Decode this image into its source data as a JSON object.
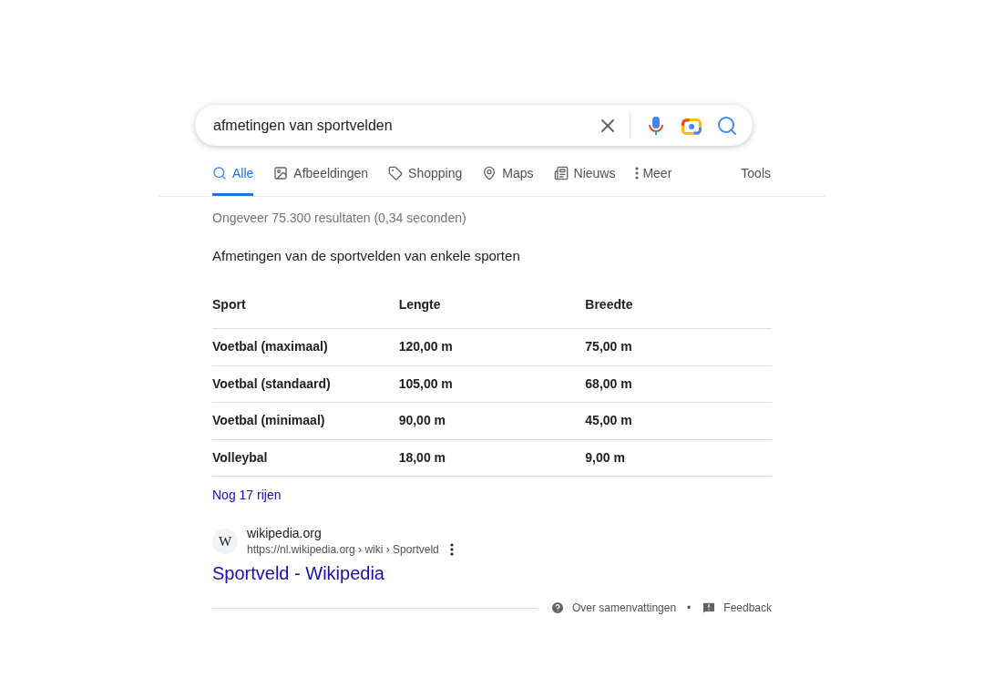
{
  "search": {
    "value": "afmetingen van sportvelden"
  },
  "tabs": [
    {
      "label": "Alle",
      "kind": "search",
      "selected": true
    },
    {
      "label": "Afbeeldingen",
      "kind": "image",
      "selected": false
    },
    {
      "label": "Shopping",
      "kind": "tag",
      "selected": false
    },
    {
      "label": "Maps",
      "kind": "pin",
      "selected": false
    },
    {
      "label": "Nieuws",
      "kind": "news",
      "selected": false
    },
    {
      "label": "Meer",
      "kind": "more",
      "selected": false
    }
  ],
  "tools": "Tools",
  "result_stats": "Ongeveer 75.300 resultaten (0,34 seconden)",
  "snippet": {
    "title": "Afmetingen van de sportvelden van enkele sporten",
    "table": {
      "columns": [
        "Sport",
        "Lengte",
        "Breedte"
      ],
      "rows": [
        [
          "Voetbal (maximaal)",
          "120,00 m",
          "75,00 m"
        ],
        [
          "Voetbal (standaard)",
          "105,00 m",
          "68,00 m"
        ],
        [
          "Voetbal (minimaal)",
          "90,00 m",
          "45,00 m"
        ],
        [
          "Volleybal",
          "18,00 m",
          "9,00 m"
        ]
      ]
    },
    "more_rows": "Nog 17 rijen",
    "source": {
      "favicon": "W",
      "site": "wikipedia.org",
      "url": "https://nl.wikipedia.org › wiki › Sportveld",
      "title": "Sportveld - Wikipedia"
    }
  },
  "footer": {
    "about": "Over samenvattingen",
    "separator": "•",
    "feedback": "Feedback"
  }
}
